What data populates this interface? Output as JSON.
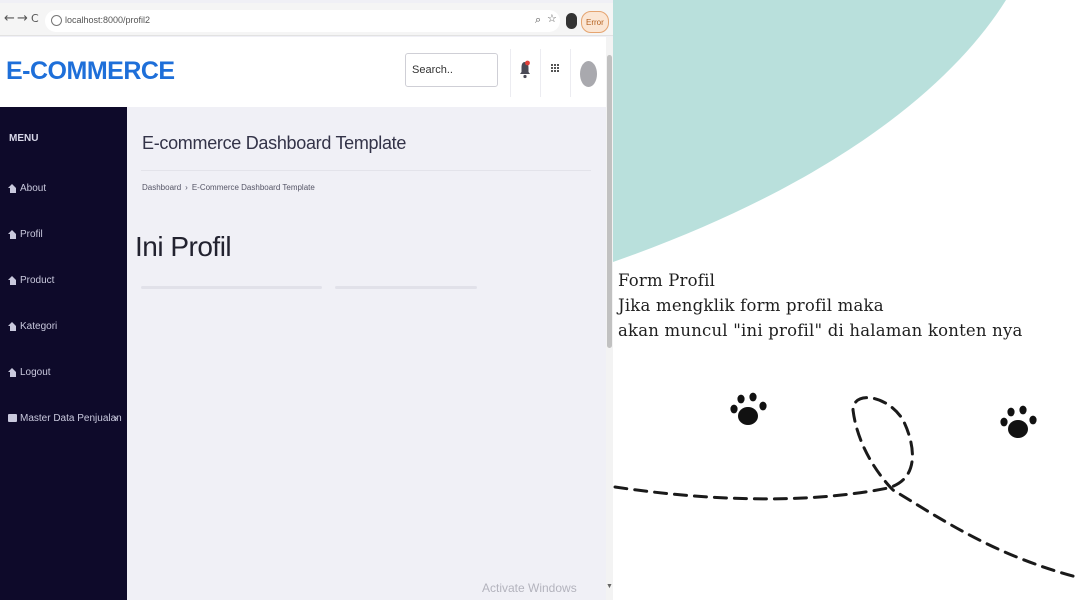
{
  "browser": {
    "url": "localhost:8000/profil2",
    "error_label": "Error",
    "back_icon": "←",
    "forward_icon": "→",
    "reload_icon": "C"
  },
  "header": {
    "logo": "E-COMMERCE",
    "search_placeholder": "Search.."
  },
  "sidebar": {
    "menu_title": "MENU",
    "items": [
      {
        "label": "About",
        "icon": "home-icon"
      },
      {
        "label": "Profil",
        "icon": "home-icon"
      },
      {
        "label": "Product",
        "icon": "home-icon"
      },
      {
        "label": "Kategori",
        "icon": "home-icon"
      },
      {
        "label": "Logout",
        "icon": "home-icon"
      },
      {
        "label": "Master Data Penjualan",
        "icon": "folder-icon"
      }
    ]
  },
  "content": {
    "page_title": "E-commerce Dashboard Template",
    "breadcrumb": [
      "Dashboard",
      "E-Commerce Dashboard Template"
    ],
    "heading": "Ini Profil"
  },
  "watermark": "Activate Windows",
  "note": {
    "lines": [
      "Form Profil",
      "Jika mengklik form profil maka",
      "akan muncul \"ini profil\" di halaman konten nya"
    ]
  },
  "colors": {
    "brand": "#1e6fd9",
    "sidebar_bg": "#0e0a2a",
    "content_bg": "#f0f0f6",
    "teal_decoration": "#b9e0dc"
  }
}
